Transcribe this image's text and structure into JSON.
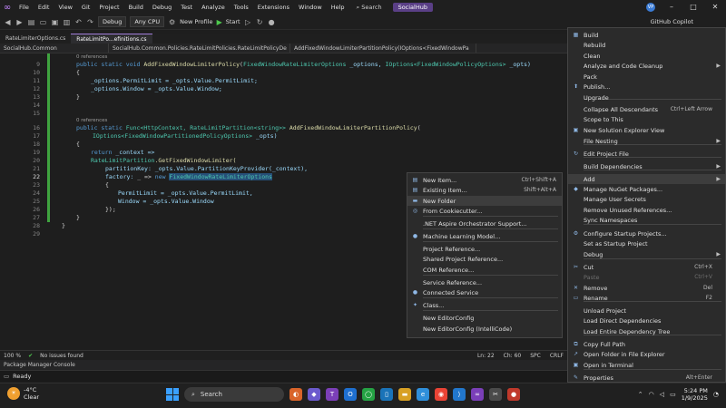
{
  "titlebar": {
    "menu": [
      "File",
      "Edit",
      "View",
      "Git",
      "Project",
      "Build",
      "Debug",
      "Test",
      "Analyze",
      "Tools",
      "Extensions",
      "Window",
      "Help"
    ],
    "search": "Search",
    "solution_name": "SocialHub",
    "avatar": "VP"
  },
  "toolbar": {
    "config": "Debug",
    "platform": "Any CPU",
    "profile": "New Profile",
    "start": "Start",
    "copilot": "GitHub Copilot"
  },
  "tabs": [
    {
      "label": "RateLimiterOptions.cs",
      "active": false
    },
    {
      "label": "RateLimitPo...efinitions.cs",
      "active": true
    }
  ],
  "navbar": {
    "project": "SocialHub.Common",
    "type": "SocialHub.Common.Policies.RateLimitPolicies.RateLimitPolicyDe",
    "member": "AddFixedWindowLimiterPartitionPolicy(IOptions<FixedWindowPa"
  },
  "editor": {
    "lines": [
      9,
      10,
      11,
      12,
      13,
      14,
      15,
      16,
      17,
      18,
      19,
      20,
      21,
      22,
      23,
      24,
      25,
      26,
      27,
      28,
      29
    ],
    "current_line": 22,
    "refs_label": "0 references",
    "code": {
      "l9_a": "public static void ",
      "l9_fn": "AddFixedWindowLimiterPolicy",
      "l9_b": "(",
      "l9_t1": "FixedWindowRateLimiterOptions",
      "l9_c": " _options, ",
      "l9_t2": "IOptions<FixedWindowPolicyOptions>",
      "l9_d": " _opts)",
      "l10": "{",
      "l11": "_options.PermitLimit = _opts.Value.PermitLimit;",
      "l12": "_options.Window = _opts.Value.Window;",
      "l13": "}",
      "l16_a": "public static ",
      "l16_t1": "Func<HttpContext, RateLimitPartition<string>>",
      "l16_fn": " AddFixedWindowLimiterPartitionPolicy",
      "l16_b": "(",
      "l17_t": "IOptions<FixedWindowPartitionedPolicyOptions>",
      "l17_b": " _opts)",
      "l18": "{",
      "l19_kw": "return",
      "l19_b": " _context =>",
      "l20_t": "RateLimitPartition",
      "l20_fn": ".GetFixedWindowLimiter(",
      "l21_p": "partitionKey:",
      "l21_b": " _opts.Value.PartitionKeyProvider(_context),",
      "l22_p": "factory:",
      "l22_b": " _ => ",
      "l22_kw": "new",
      "l22_sel": "FixedWindowRateLimiterOptions",
      "l23": "{",
      "l24": "PermitLimit = _opts.Value.PermitLimit,",
      "l25": "Window = _opts.Value.Window",
      "l26": "});",
      "l27": "}",
      "l28": "}"
    }
  },
  "editor_status": {
    "zoom": "100 %",
    "issues": "No issues found",
    "ln": "Ln: 22",
    "ch": "Ch: 60",
    "spc": "SPC",
    "crlf": "CRLF"
  },
  "bottom_tab": "Package Manager Console",
  "statusbar": {
    "state": "Ready"
  },
  "context_menu": [
    {
      "label": "Build",
      "shortcut": "",
      "arrow": false,
      "icon": "build-icon",
      "glyph": "▦"
    },
    {
      "label": "Rebuild",
      "shortcut": "",
      "arrow": false,
      "icon": "rebuild-icon",
      "glyph": ""
    },
    {
      "label": "Clean",
      "shortcut": "",
      "arrow": false,
      "icon": "",
      "glyph": ""
    },
    {
      "label": "Analyze and Code Cleanup",
      "shortcut": "",
      "arrow": true,
      "icon": "",
      "glyph": ""
    },
    {
      "label": "Pack",
      "shortcut": "",
      "arrow": false,
      "icon": "",
      "glyph": ""
    },
    {
      "label": "Publish...",
      "shortcut": "",
      "arrow": false,
      "icon": "publish-icon",
      "glyph": "⬆"
    },
    {
      "label": "Upgrade",
      "shortcut": "",
      "arrow": false,
      "icon": "",
      "glyph": ""
    },
    {
      "label": "Collapse All Descendants",
      "shortcut": "Ctrl+Left Arrow",
      "arrow": false,
      "icon": "",
      "glyph": ""
    },
    {
      "label": "Scope to This",
      "shortcut": "",
      "arrow": false,
      "icon": "",
      "glyph": ""
    },
    {
      "label": "New Solution Explorer View",
      "shortcut": "",
      "arrow": false,
      "icon": "new-view-icon",
      "glyph": "▣"
    },
    {
      "label": "File Nesting",
      "shortcut": "",
      "arrow": true,
      "icon": "",
      "glyph": ""
    },
    {
      "label": "Edit Project File",
      "shortcut": "",
      "arrow": false,
      "icon": "edit-file-icon",
      "glyph": "↻"
    },
    {
      "label": "Build Dependencies",
      "shortcut": "",
      "arrow": true,
      "icon": "",
      "glyph": ""
    },
    {
      "label": "Add",
      "shortcut": "",
      "arrow": true,
      "icon": "",
      "glyph": "",
      "highlight": true
    },
    {
      "label": "Manage NuGet Packages...",
      "shortcut": "",
      "arrow": false,
      "icon": "nuget-icon",
      "glyph": "◆"
    },
    {
      "label": "Manage User Secrets",
      "shortcut": "",
      "arrow": false,
      "icon": "",
      "glyph": ""
    },
    {
      "label": "Remove Unused References...",
      "shortcut": "",
      "arrow": false,
      "icon": "",
      "glyph": ""
    },
    {
      "label": "Sync Namespaces",
      "shortcut": "",
      "arrow": false,
      "icon": "",
      "glyph": ""
    },
    {
      "label": "Configure Startup Projects...",
      "shortcut": "",
      "arrow": false,
      "icon": "settings-icon",
      "glyph": "⚙"
    },
    {
      "label": "Set as Startup Project",
      "shortcut": "",
      "arrow": false,
      "icon": "",
      "glyph": ""
    },
    {
      "label": "Debug",
      "shortcut": "",
      "arrow": true,
      "icon": "",
      "glyph": ""
    },
    {
      "label": "Cut",
      "shortcut": "Ctrl+X",
      "arrow": false,
      "icon": "cut-icon",
      "glyph": "✂"
    },
    {
      "label": "Paste",
      "shortcut": "Ctrl+V",
      "arrow": false,
      "icon": "paste-icon",
      "glyph": "",
      "disabled": true
    },
    {
      "label": "Remove",
      "shortcut": "Del",
      "arrow": false,
      "icon": "remove-icon",
      "glyph": "✕"
    },
    {
      "label": "Rename",
      "shortcut": "F2",
      "arrow": false,
      "icon": "rename-icon",
      "glyph": "▭"
    },
    {
      "label": "Unload Project",
      "shortcut": "",
      "arrow": false,
      "icon": "",
      "glyph": ""
    },
    {
      "label": "Load Direct Dependencies",
      "shortcut": "",
      "arrow": false,
      "icon": "",
      "glyph": ""
    },
    {
      "label": "Load Entire Dependency Tree",
      "shortcut": "",
      "arrow": false,
      "icon": "",
      "glyph": ""
    },
    {
      "label": "Copy Full Path",
      "shortcut": "",
      "arrow": false,
      "icon": "copy-icon",
      "glyph": "⧉"
    },
    {
      "label": "Open Folder in File Explorer",
      "shortcut": "",
      "arrow": false,
      "icon": "folder-icon",
      "glyph": "↗"
    },
    {
      "label": "Open in Terminal",
      "shortcut": "",
      "arrow": false,
      "icon": "terminal-icon",
      "glyph": "▣"
    },
    {
      "label": "Properties",
      "shortcut": "Alt+Enter",
      "arrow": false,
      "icon": "properties-icon",
      "glyph": "✎"
    }
  ],
  "add_submenu": [
    {
      "label": "New Item...",
      "shortcut": "Ctrl+Shift+A",
      "icon": "new-item-icon",
      "glyph": "▤"
    },
    {
      "label": "Existing Item...",
      "shortcut": "Shift+Alt+A",
      "icon": "existing-item-icon",
      "glyph": "▤"
    },
    {
      "label": "New Folder",
      "shortcut": "",
      "icon": "new-folder-icon",
      "glyph": "▬",
      "highlight": true
    },
    {
      "label": "From Cookiecutter...",
      "shortcut": "",
      "icon": "cookiecutter-icon",
      "glyph": "◎"
    },
    {
      "label": ".NET Aspire Orchestrator Support...",
      "shortcut": "",
      "icon": "",
      "glyph": ""
    },
    {
      "label": "Machine Learning Model...",
      "shortcut": "",
      "icon": "ml-icon",
      "glyph": "●"
    },
    {
      "label": "Project Reference...",
      "shortcut": "",
      "icon": "",
      "glyph": ""
    },
    {
      "label": "Shared Project Reference...",
      "shortcut": "",
      "icon": "",
      "glyph": ""
    },
    {
      "label": "COM Reference...",
      "shortcut": "",
      "icon": "",
      "glyph": ""
    },
    {
      "label": "Service Reference...",
      "shortcut": "",
      "icon": "",
      "glyph": ""
    },
    {
      "label": "Connected Service",
      "shortcut": "",
      "icon": "connected-service-icon",
      "glyph": "●"
    },
    {
      "label": "Class...",
      "shortcut": "",
      "icon": "class-icon",
      "glyph": "✦"
    },
    {
      "label": "New EditorConfig",
      "shortcut": "",
      "icon": "",
      "glyph": ""
    },
    {
      "label": "New EditorConfig (IntelliCode)",
      "shortcut": "",
      "icon": "",
      "glyph": ""
    }
  ],
  "taskbar": {
    "temp": "-4°C",
    "weather": "Clear",
    "search": "Search",
    "time": "5:24 PM",
    "date": "1/9/2025"
  },
  "colors": {
    "accent": "#5a3f86",
    "green": "#3fa33f",
    "selection": "#264f78"
  }
}
